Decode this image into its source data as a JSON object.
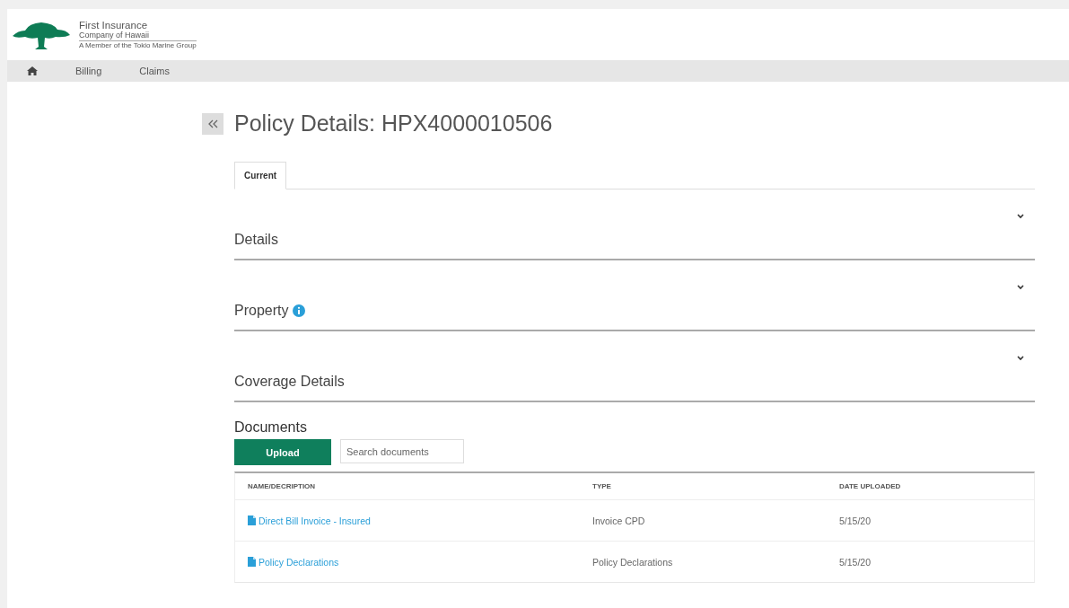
{
  "logo": {
    "line_1": "First Insurance",
    "line_2": "Company of Hawaii",
    "tagline": "A Member of the Tokio Marine Group"
  },
  "nav": [
    {
      "kind": "home"
    },
    {
      "kind": "text",
      "label": "Billing"
    },
    {
      "kind": "text",
      "label": "Claims"
    }
  ],
  "page_title": "Policy Details: HPX4000010506",
  "tabs": [
    {
      "label": "Current",
      "selected": true
    }
  ],
  "sections": [
    {
      "title": "Details",
      "info_icon": false,
      "expanded": false
    },
    {
      "title": "Property",
      "info_icon": true,
      "expanded": false
    },
    {
      "title": "Coverage Details",
      "info_icon": false,
      "expanded": false
    }
  ],
  "documents": {
    "title": "Documents",
    "upload_button": "Upload",
    "search": {
      "placeholder": "Search documents"
    },
    "columns": [
      "NAME/DECRIPTION",
      "TYPE",
      "DATE UPLOADED"
    ],
    "rows": [
      {
        "name": "Direct Bill Invoice - Insured",
        "type": "Invoice CPD",
        "date": "5/15/20"
      },
      {
        "name": "Policy Declarations",
        "type": "Policy Declarations",
        "date": "5/15/20"
      }
    ]
  }
}
